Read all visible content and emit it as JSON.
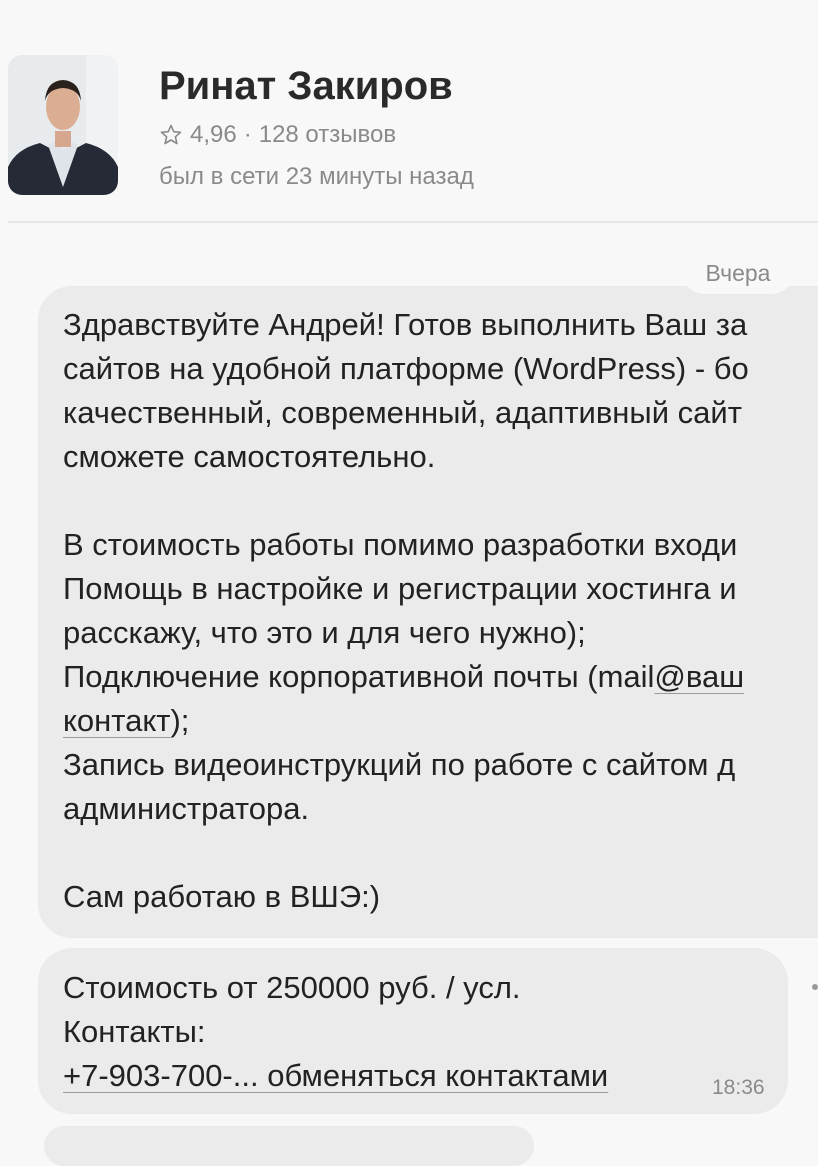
{
  "profile": {
    "name": "Ринат Закиров",
    "rating": "4,96",
    "separator": "·",
    "reviews": "128 отзывов",
    "last_seen": "был в сети 23 минуты назад"
  },
  "chat": {
    "date_label": "Вчера",
    "messages": [
      {
        "lines": {
          "l1": "Здравствуйте Андрей! Готов выполнить Ваш за",
          "l2": "сайтов на удобной платформе (WordPress) - бо",
          "l3": "качественный, современный, адаптивный сайт",
          "l4": "сможете самостоятельно.",
          "l5": "В стоимость работы помимо разработки входи",
          "l6": "Помощь в настройке и регистрации хостинга и",
          "l7": "расскажу, что это и для чего нужно);",
          "l8a": "Подключение корпоративной почты (mail",
          "l8b": "@ваш",
          "l9a": "контакт",
          "l9b": ");",
          "l10": "Запись видеоинструкций по работе с сайтом д",
          "l11": "администратора.",
          "l12": "Сам работаю в ВШЭ:)"
        }
      },
      {
        "lines": {
          "l1": "Стоимость от 250000 руб. / усл.",
          "l2": "Контакты:",
          "l3": "+7-903-700-... обменяться контактами"
        },
        "time": "18:36"
      }
    ]
  },
  "icons": {
    "rating": "star-outline-icon"
  },
  "colors": {
    "background": "#f8f8f8",
    "bubble": "#ebebeb",
    "secondary_text": "#8a8a8a",
    "primary_text": "#222222"
  }
}
